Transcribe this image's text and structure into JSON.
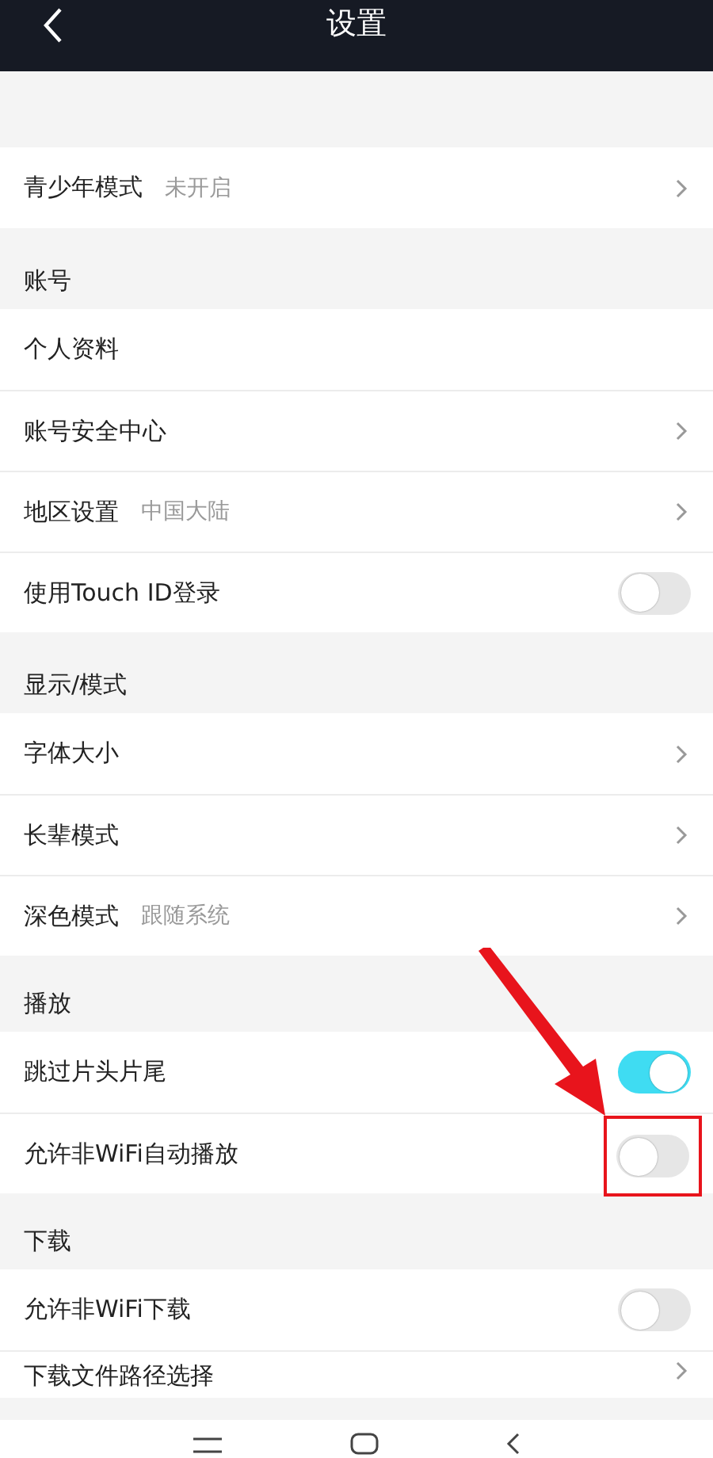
{
  "header": {
    "title": "设置"
  },
  "sections": [
    {
      "items": [
        {
          "kind": "link",
          "label": "青少年模式",
          "value": "未开启"
        }
      ]
    },
    {
      "title": "账号",
      "items": [
        {
          "kind": "plain",
          "label": "个人资料"
        },
        {
          "kind": "link",
          "label": "账号安全中心"
        },
        {
          "kind": "link",
          "label": "地区设置",
          "value": "中国大陆"
        },
        {
          "kind": "toggle",
          "label": "使用Touch ID登录",
          "on": false
        }
      ]
    },
    {
      "title": "显示/模式",
      "items": [
        {
          "kind": "link",
          "label": "字体大小"
        },
        {
          "kind": "link",
          "label": "长辈模式"
        },
        {
          "kind": "link",
          "label": "深色模式",
          "value": "跟随系统"
        }
      ]
    },
    {
      "title": "播放",
      "items": [
        {
          "kind": "toggle",
          "label": "跳过片头片尾",
          "on": true
        },
        {
          "kind": "toggle",
          "label": "允许非WiFi自动播放",
          "on": false,
          "annotated": true
        }
      ]
    },
    {
      "title": "下载",
      "items": [
        {
          "kind": "toggle",
          "label": "允许非WiFi下载",
          "on": false
        },
        {
          "kind": "link",
          "label": "下载文件路径选择",
          "partial": true
        }
      ]
    }
  ]
}
